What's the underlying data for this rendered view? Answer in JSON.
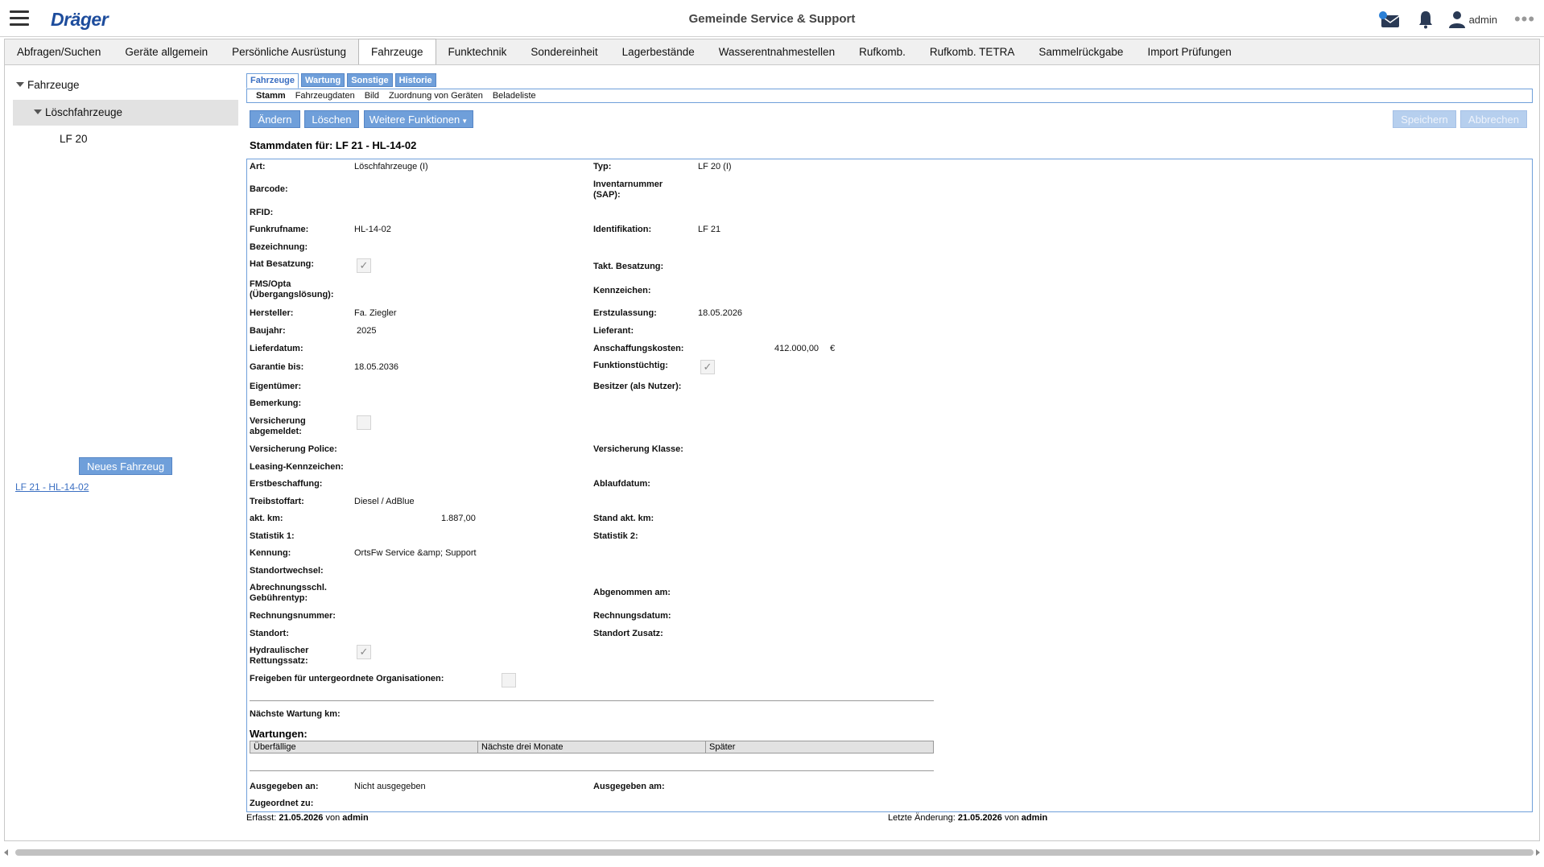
{
  "app": {
    "logo": "Dräger",
    "title": "Gemeinde Service & Support",
    "user": "admin"
  },
  "main_tabs": [
    "Abfragen/Suchen",
    "Geräte allgemein",
    "Persönliche Ausrüstung",
    "Fahrzeuge",
    "Funktechnik",
    "Sondereinheit",
    "Lagerbestände",
    "Wasserentnahmestellen",
    "Rufkomb.",
    "Rufkomb. TETRA",
    "Sammelrückgabe",
    "Import Prüfungen"
  ],
  "active_main_tab": "Fahrzeuge",
  "tree": {
    "root": "Fahrzeuge",
    "child": "Löschfahrzeuge",
    "leaf": "LF 20"
  },
  "left": {
    "new_button": "Neues Fahrzeug",
    "vehicle_link": "LF 21 - HL-14-02"
  },
  "sub_tabs": [
    "Fahrzeuge",
    "Wartung",
    "Sonstige",
    "Historie"
  ],
  "sub_tabs2": [
    "Stamm",
    "Fahrzeugdaten",
    "Bild",
    "Zuordnung von Geräten",
    "Beladeliste"
  ],
  "buttons": {
    "change": "Ändern",
    "delete": "Löschen",
    "more": "Weitere Funktionen",
    "save": "Speichern",
    "cancel": "Abbrechen"
  },
  "stamm_title": "Stammdaten für: LF 21 - HL-14-02",
  "fields": {
    "art_l": "Art:",
    "art_v": "Löschfahrzeuge (I)",
    "typ_l": "Typ:",
    "typ_v": "LF 20 (I)",
    "barcode_l": "Barcode:",
    "inventar_l1": "Inventarnummer",
    "inventar_l2": "(SAP):",
    "rfid_l": "RFID:",
    "funkruf_l": "Funkrufname:",
    "funkruf_v": "HL-14-02",
    "ident_l": "Identifikation:",
    "ident_v": "LF 21",
    "bez_l": "Bezeichnung:",
    "hatbes_l": "Hat Besatzung:",
    "takt_l": "Takt. Besatzung:",
    "fms_l1": "FMS/Opta",
    "fms_l2": "(Übergangslösung):",
    "kennz_l": "Kennzeichen:",
    "herst_l": "Hersteller:",
    "herst_v": "Fa. Ziegler",
    "erstzu_l": "Erstzulassung:",
    "erstzu_v": "18.05.2026",
    "baujahr_l": "Baujahr:",
    "baujahr_v": "2025",
    "lieferant_l": "Lieferant:",
    "lieferdatum_l": "Lieferdatum:",
    "anschaff_l": "Anschaffungskosten:",
    "anschaff_v": "412.000,00",
    "anschaff_cur": "€",
    "garantie_l": "Garantie bis:",
    "garantie_v": "18.05.2036",
    "funktion_l": "Funktionstüchtig:",
    "eigent_l": "Eigentümer:",
    "besitzer_l": "Besitzer (als Nutzer):",
    "bemerk_l": "Bemerkung:",
    "versab_l1": "Versicherung",
    "versab_l2": "abgemeldet:",
    "verspol_l": "Versicherung Police:",
    "verskl_l": "Versicherung Klasse:",
    "leasing_l": "Leasing-Kennzeichen:",
    "erstbesch_l": "Erstbeschaffung:",
    "ablauf_l": "Ablaufdatum:",
    "treib_l": "Treibstoffart:",
    "treib_v": "Diesel / AdBlue",
    "aktkm_l": "akt. km:",
    "aktkm_v": "1.887,00",
    "standkm_l": "Stand akt. km:",
    "stat1_l": "Statistik 1:",
    "stat2_l": "Statistik 2:",
    "kennung_l": "Kennung:",
    "kennung_v": "OrtsFw Service &amp; Support",
    "standwech_l": "Standortwechsel:",
    "abrech_l1": "Abrechnungsschl.",
    "abrech_l2": "Gebührentyp:",
    "abgenom_l": "Abgenommen am:",
    "rechnr_l": "Rechnungsnummer:",
    "rechdat_l": "Rechnungsdatum:",
    "standort_l": "Standort:",
    "standzus_l": "Standort Zusatz:",
    "hydr_l1": "Hydraulischer",
    "hydr_l2": "Rettungssatz:",
    "freigabe_l": "Freigeben für untergeordnete Organisationen:",
    "naechste_l": "Nächste Wartung km:",
    "ausgeg_an_l": "Ausgegeben an:",
    "ausgeg_an_v": "Nicht ausgegeben",
    "ausgeg_am_l": "Ausgegeben am:",
    "zugeord_l": "Zugeordnet zu:"
  },
  "checks": {
    "hat_besatzung": true,
    "funktionstuechtig": true,
    "versicherung_abgemeldet": false,
    "hydraulischer_rettungssatz": true,
    "freigeben": false
  },
  "wartungen": {
    "title": "Wartungen:",
    "columns": [
      "Überfällige",
      "Nächste drei Monate",
      "Später"
    ]
  },
  "footer": {
    "erfasst_label": "Erfasst:",
    "erfasst_date": "21.05.2026",
    "erfasst_von": "von",
    "erfasst_user": "admin",
    "aend_label": "Letzte Änderung:",
    "aend_date": "21.05.2026",
    "aend_von": "von",
    "aend_user": "admin"
  },
  "colors": {
    "accent": "#6f9fda",
    "logo": "#1d4c9c"
  }
}
